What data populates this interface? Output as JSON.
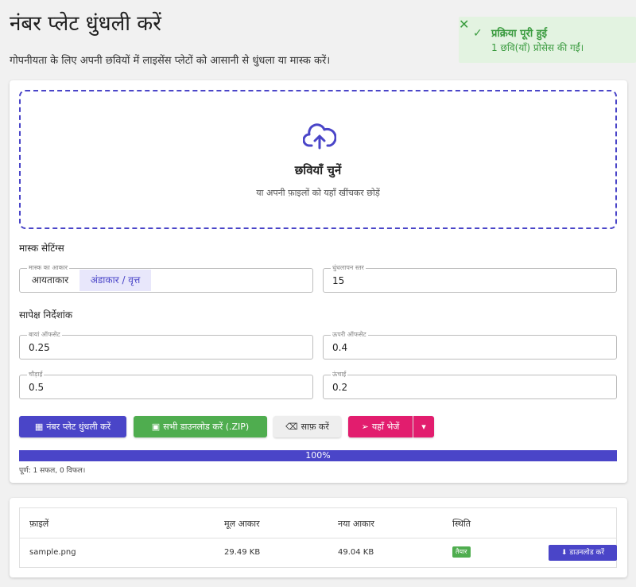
{
  "header": {
    "title": "नंबर प्लेट धुंधली करें",
    "subtitle": "गोपनीयता के लिए अपनी छवियों में लाइसेंस प्लेटों को आसानी से धुंधला या मास्क करें।"
  },
  "toast": {
    "title": "प्रक्रिया पूरी हुई",
    "message": "1 छवि(याँ) प्रोसेस की गईं।",
    "close": "✕",
    "check": "✓"
  },
  "dropzone": {
    "title": "छवियाँ चुनें",
    "subtitle": "या अपनी फ़ाइलों को यहाँ खींचकर छोड़ें"
  },
  "mask": {
    "section": "मास्क सेटिंग्स",
    "shape_label": "मास्क का आकार",
    "shape_options": [
      "आयताकार",
      "अंडाकार / वृत्त"
    ],
    "blur_label": "धुंधलापन स्तर",
    "blur_value": "15"
  },
  "coords": {
    "section": "सापेक्ष निर्देशांक",
    "left_label": "बायां ऑफसेट",
    "left_value": "0.25",
    "top_label": "ऊपरी ऑफसेट",
    "top_value": "0.4",
    "width_label": "चौड़ाई",
    "width_value": "0.5",
    "height_label": "ऊंचाई",
    "height_value": "0.2"
  },
  "actions": {
    "blur": "नंबर प्लेट धुंधली करें",
    "zip": "सभी डाउनलोड करें (.ZIP)",
    "clear": "साफ़ करें",
    "send": "यहाँ भेजें",
    "caret": "▾"
  },
  "progress": {
    "value": 1.0,
    "label": "100%",
    "status": "पूर्ण: 1 सफल, 0 विफल।"
  },
  "files": {
    "headers": [
      "फ़ाइलें",
      "मूल आकार",
      "नया आकार",
      "स्थिति"
    ],
    "rows": [
      {
        "name": "sample.png",
        "original": "29.49 KB",
        "new": "49.04 KB",
        "status": "तैयार",
        "action": "डाउनलोड करें"
      }
    ]
  },
  "colors": {
    "accent": "#4a45c8",
    "success": "#4fad4f",
    "send": "#e21d6e"
  }
}
